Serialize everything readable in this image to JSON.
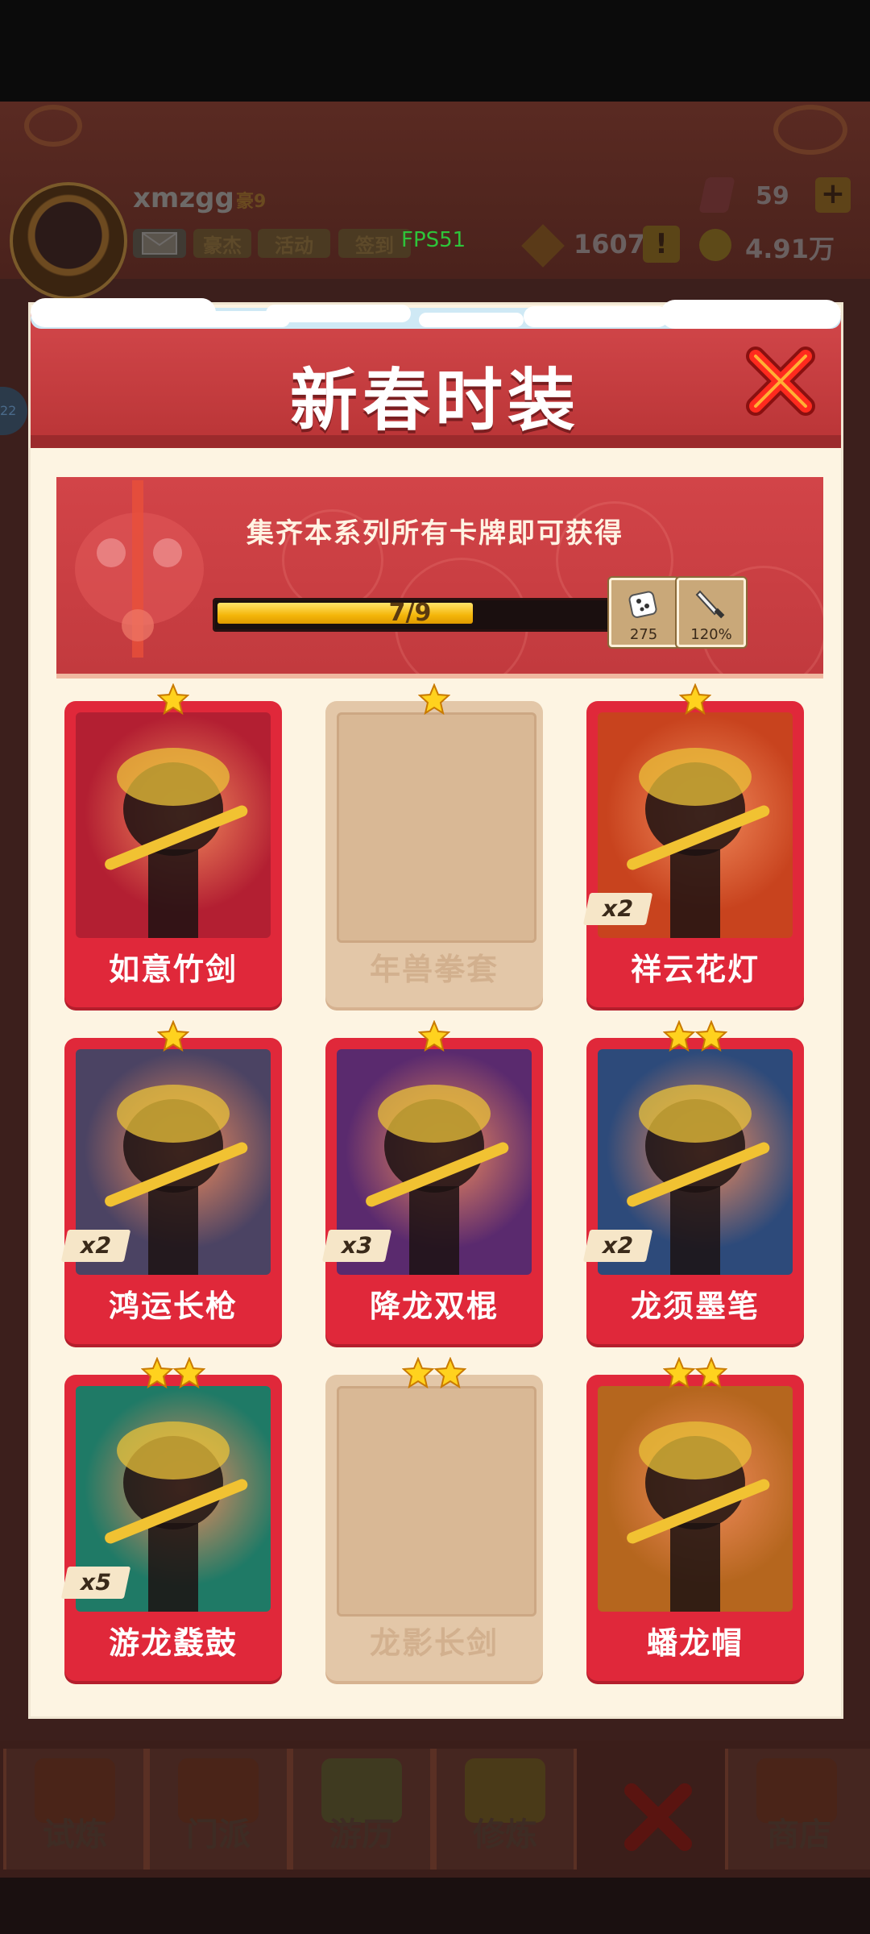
{
  "player": {
    "username": "xmzgg",
    "vip_label": "豪9",
    "chips": [
      "豪杰",
      "活动",
      "签到"
    ],
    "gems": "59",
    "coins": "1607",
    "gold": "4.91万",
    "side_badge": "22"
  },
  "debug": {
    "fps": "FPS51"
  },
  "dialog": {
    "title": "新春时装",
    "banner_text": "集齐本系列所有卡牌即可获得",
    "progress": {
      "current": 7,
      "total": 9,
      "label": "7/9",
      "fraction": 0.7778
    },
    "rewards": [
      {
        "icon": "dice-icon",
        "value": "275"
      },
      {
        "icon": "sword-icon",
        "value": "120%"
      }
    ]
  },
  "cards": [
    {
      "name": "如意竹剑",
      "stars": 1,
      "count": "",
      "owned": true,
      "art": "#b31f32"
    },
    {
      "name": "年兽拳套",
      "stars": 1,
      "count": "",
      "owned": false,
      "art": ""
    },
    {
      "name": "祥云花灯",
      "stars": 1,
      "count": "x2",
      "owned": true,
      "art": "#c8431e"
    },
    {
      "name": "鸿运长枪",
      "stars": 1,
      "count": "x2",
      "owned": true,
      "art": "#4b4363"
    },
    {
      "name": "降龙双棍",
      "stars": 1,
      "count": "x3",
      "owned": true,
      "art": "#5a2a6e"
    },
    {
      "name": "龙须墨笔",
      "stars": 2,
      "count": "x2",
      "owned": true,
      "art": "#2d4a7a"
    },
    {
      "name": "游龙鼗鼓",
      "stars": 2,
      "count": "x5",
      "owned": true,
      "art": "#1f7a66"
    },
    {
      "name": "龙影长剑",
      "stars": 2,
      "count": "",
      "owned": false,
      "art": ""
    },
    {
      "name": "蟠龙帽",
      "stars": 2,
      "count": "",
      "owned": true,
      "art": "#b5661e"
    }
  ],
  "bottom_nav": [
    "试炼",
    "门派",
    "游历",
    "修炼",
    "",
    "商店"
  ],
  "colors": {
    "accent_red": "#e0283a",
    "header_red": "#c93e40",
    "gold": "#f4b60a"
  }
}
